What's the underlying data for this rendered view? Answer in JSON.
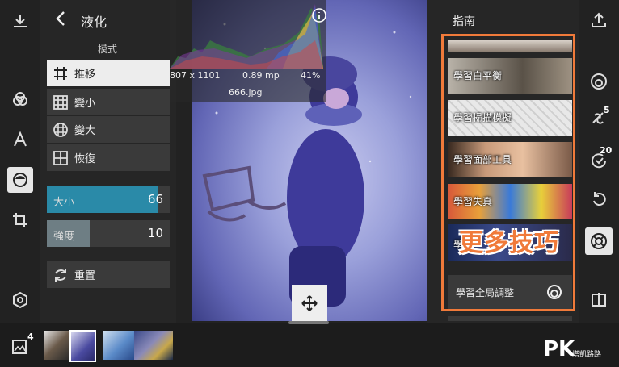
{
  "left_toolbar": {
    "icons": [
      "download-icon",
      "color-circles-icon",
      "text-icon",
      "face-icon",
      "crop-icon",
      "settings-hex-icon"
    ]
  },
  "panel": {
    "back_label": "<",
    "title": "液化",
    "mode_label": "模式",
    "modes": [
      {
        "label": "推移",
        "selected": true
      },
      {
        "label": "變小",
        "selected": false
      },
      {
        "label": "變大",
        "selected": false
      },
      {
        "label": "恢復",
        "selected": false
      }
    ],
    "sliders": [
      {
        "label": "大小",
        "value": "66",
        "level": 0.66,
        "color": "#2a8aa8"
      },
      {
        "label": "強度",
        "value": "10",
        "level": 0.1,
        "color": "#6e7e84"
      }
    ],
    "reset_label": "重置"
  },
  "image_info": {
    "dimensions": "807 x 1101",
    "megapixels": "0.89 mp",
    "percent": "41%",
    "filename": "666.jpg"
  },
  "guide": {
    "title": "指南",
    "items": [
      {
        "label": "學習白平衡"
      },
      {
        "label": "學習掃描模擬"
      },
      {
        "label": "學習面部工具"
      },
      {
        "label": "學習失真"
      },
      {
        "label": "學習"
      }
    ],
    "more_tips": "更多技巧",
    "global_adjust_label": "學習全局調整"
  },
  "right_toolbar": {
    "icons": [
      "share-icon",
      "spiral-icon",
      "healing-icon",
      "history-icon",
      "undo-icon",
      "help-ring-icon",
      "compare-icon"
    ],
    "healing_badge": "5",
    "history_badge": "20"
  },
  "bottom_bar": {
    "gallery_badge": "4",
    "watermark_main": "PK",
    "watermark_sub": "塔凱路路"
  },
  "colors": {
    "accent": "#f07a3a",
    "highlight_frame": "#f07a3a"
  }
}
